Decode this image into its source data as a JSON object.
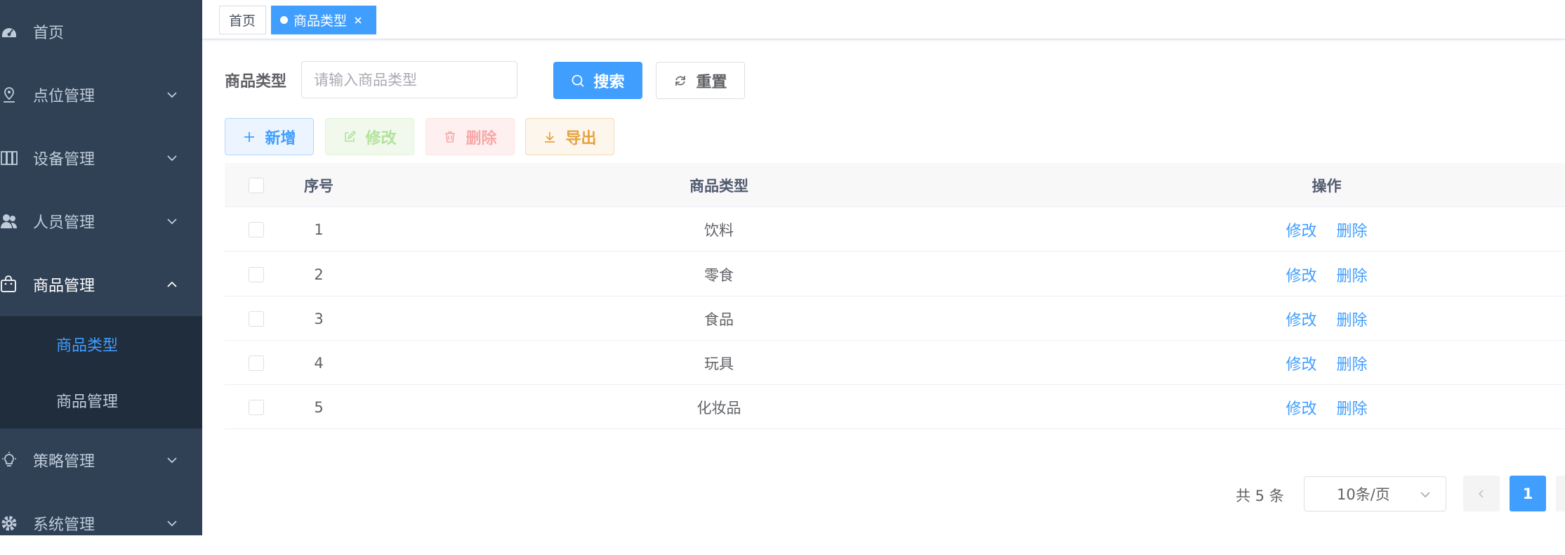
{
  "sidebar": {
    "menu": [
      {
        "label": "首页",
        "icon": "dashboard-icon",
        "has_chevron": false
      },
      {
        "label": "点位管理",
        "icon": "location-pin-icon",
        "has_chevron": true
      },
      {
        "label": "设备管理",
        "icon": "device-icon",
        "has_chevron": true
      },
      {
        "label": "人员管理",
        "icon": "users-icon",
        "has_chevron": true
      },
      {
        "label": "商品管理",
        "icon": "shopping-bag-icon",
        "has_chevron": true,
        "expanded": true
      },
      {
        "label": "策略管理",
        "icon": "lightbulb-icon",
        "has_chevron": true
      },
      {
        "label": "系统管理",
        "icon": "gear-icon",
        "has_chevron": true
      }
    ],
    "submenu": [
      {
        "label": "商品类型",
        "active": true
      },
      {
        "label": "商品管理",
        "active": false
      }
    ]
  },
  "tags": {
    "home": "首页",
    "active": "商品类型"
  },
  "search": {
    "label": "商品类型",
    "placeholder": "请输入商品类型",
    "value": "",
    "search_button": "搜索",
    "reset_button": "重置"
  },
  "toolbar": {
    "add": "新增",
    "edit": "修改",
    "delete": "删除",
    "export": "导出"
  },
  "table": {
    "headers": {
      "index": "序号",
      "name": "商品类型",
      "op": "操作"
    },
    "rows": [
      {
        "index": "1",
        "name": "饮料"
      },
      {
        "index": "2",
        "name": "零食"
      },
      {
        "index": "3",
        "name": "食品"
      },
      {
        "index": "4",
        "name": "玩具"
      },
      {
        "index": "5",
        "name": "化妆品"
      }
    ],
    "row_actions": {
      "edit": "修改",
      "delete": "删除"
    }
  },
  "pagination": {
    "total": "共 5 条",
    "page_size": "10条/页",
    "current_page": "1"
  },
  "colors": {
    "sidebar_bg": "#304156",
    "submenu_bg": "#1f2d3d",
    "primary": "#409eff",
    "success_light": "#b3e19d",
    "danger_light": "#f9a7a7",
    "warning": "#e6a23c"
  }
}
